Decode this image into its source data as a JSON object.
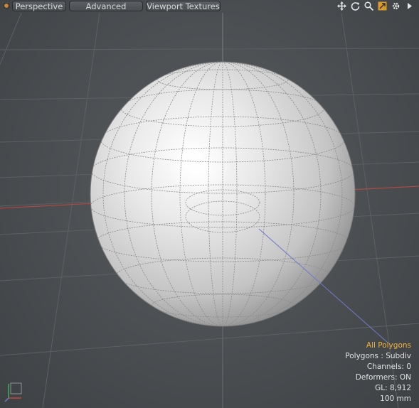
{
  "toolbar": {
    "view_mode": "Perspective",
    "shading": "Advanced",
    "textures": "Viewport Textures",
    "icons": [
      "move-view-icon",
      "rotate-view-icon",
      "zoom-view-icon",
      "fit-view-icon",
      "settings-gear-icon",
      "more-arrow-icon"
    ]
  },
  "scene": {
    "object": "sphere",
    "axis_colors": {
      "x": "#c0463f",
      "z": "#6f79c8",
      "y": "#3fb05a"
    }
  },
  "info": {
    "selection": "All Polygons",
    "polygons": "Polygons : Subdiv",
    "channels": "Channels: 0",
    "deformers": "Deformers: ON",
    "gl": "GL: 8,912",
    "grid_size": "100 mm"
  },
  "colors": {
    "accent": "#f0b43a",
    "background": "#4d5154"
  }
}
